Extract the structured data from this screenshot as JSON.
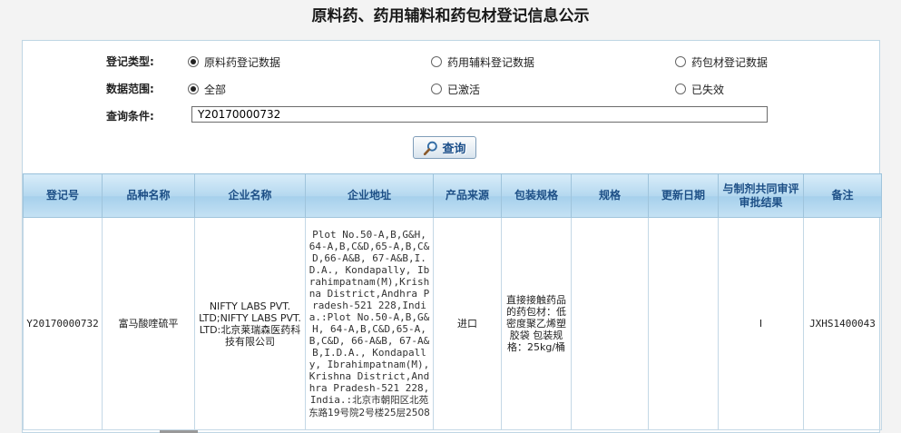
{
  "page": {
    "title": "原料药、药用辅料和药包材登记信息公示"
  },
  "filters": {
    "type_label": "登记类型:",
    "type_options": [
      {
        "label": "原料药登记数据",
        "checked": true
      },
      {
        "label": "药用辅料登记数据",
        "checked": false
      },
      {
        "label": "药包材登记数据",
        "checked": false
      }
    ],
    "scope_label": "数据范围:",
    "scope_options": [
      {
        "label": "全部",
        "checked": true
      },
      {
        "label": "已激活",
        "checked": false
      },
      {
        "label": "已失效",
        "checked": false
      }
    ],
    "query_label": "查询条件:",
    "query_value": "Y20170000732",
    "search_button": "查询"
  },
  "table": {
    "headers": [
      "登记号",
      "品种名称",
      "企业名称",
      "企业地址",
      "产品来源",
      "包装规格",
      "规格",
      "更新日期",
      "与制剂共同审评审批结果",
      "备注"
    ],
    "rows": [
      {
        "reg_no": "Y20170000732",
        "product": "富马酸喹硫平",
        "company": "NIFTY LABS PVT. LTD;NIFTY LABS PVT. LTD:北京莱瑞森医药科技有限公司",
        "address_en": "Plot No.50-A,B,G&H, 64-A,B,C&D,65-A,B,C&D,66-A&B, 67-A&B,I.D.A., Kondapally, Ibrahimpatnam(M),Krishna District,Andhra Pradesh-521 228,India.:Plot No.50-A,B,G&H, 64-A,B,C&D,65-A,B,C&D, 66-A&B, 67-A&B,I.D.A., Kondapally, Ibrahimpatnam(M),Krishna District,Andhra Pradesh-521 228,India.:",
        "address_cn": "北京市朝阳区北苑东路19号院2号楼25层2508",
        "source": "进口",
        "packaging": "直接接触药品的药包材：低密度聚乙烯塑胶袋 包装规格：25kg/桶",
        "spec": "",
        "update_date": "",
        "joint_review": "I",
        "remark": "JXHS1400043"
      }
    ]
  },
  "colors": {
    "header_text": "#1d4f86",
    "panel_border": "#bfd6e4"
  },
  "icons": {
    "search": "magnifier-icon"
  }
}
